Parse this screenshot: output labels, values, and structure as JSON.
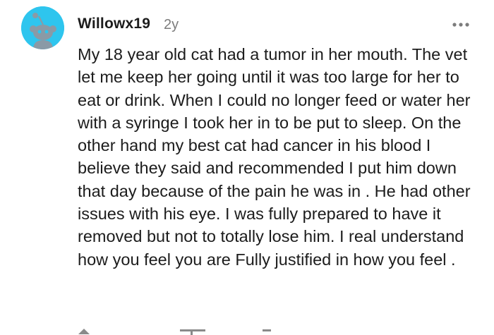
{
  "comment": {
    "author": "Willowx19",
    "age": "2y",
    "text": "My 18 year old cat had a tumor in her mouth. The vet let me keep her going until it was too large for her to eat or drink. When I could no longer feed or water her with a syringe I took her in to be put to sleep. On the other hand my best cat had cancer in his blood I believe they said and recommended I put him down that day because of the pain he was in . He had other issues with his eye. I was fully prepared to have it removed but not to totally lose him. I real understand how you feel you are Fully justified in how you feel ."
  },
  "icons": {
    "avatar": "snoo-avatar-icon",
    "more": "more-options-icon",
    "upvote": "upvote-icon",
    "reply": "reply-icon"
  },
  "colors": {
    "avatar_bg": "#2ec5ee",
    "text": "#1c1c1c",
    "muted": "#7c7c7c"
  }
}
